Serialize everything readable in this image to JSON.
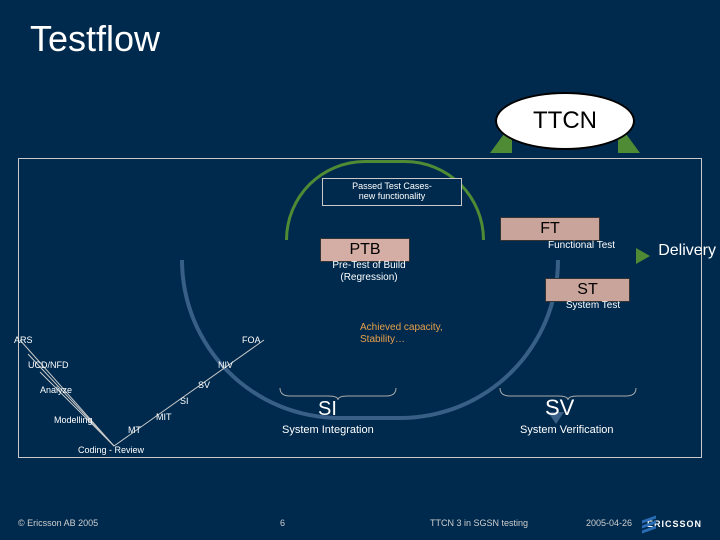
{
  "title": "Testflow",
  "ttcn": "TTCN",
  "passed": "Passed Test Cases-\nnew functionality",
  "ft": {
    "label": "FT",
    "desc": "Functional Test"
  },
  "ptb": {
    "label": "PTB",
    "desc": "Pre-Test of Build\n(Regression)"
  },
  "st": {
    "label": "ST",
    "desc": "System Test"
  },
  "achieved": "Achieved capacity,\nStability…",
  "delivery": "Delivery",
  "left_nodes": {
    "ars": "ARS",
    "ucd": "UCD/NFD",
    "analyze": "Analyze",
    "modelling": "Modelling",
    "coding": "Coding - Review",
    "mt": "MT",
    "mit": "MIT",
    "si": "SI",
    "sv": "SV",
    "niv": "NIV",
    "foa": "FOA"
  },
  "si": {
    "label": "SI",
    "desc": "System Integration"
  },
  "sv": {
    "label": "SV",
    "desc": "System Verification"
  },
  "footer": {
    "copyright": "© Ericsson AB 2005",
    "page": "6",
    "mid": "TTCN 3 in SGSN testing",
    "date": "2005-04-26",
    "logo": "ERICSSON"
  }
}
